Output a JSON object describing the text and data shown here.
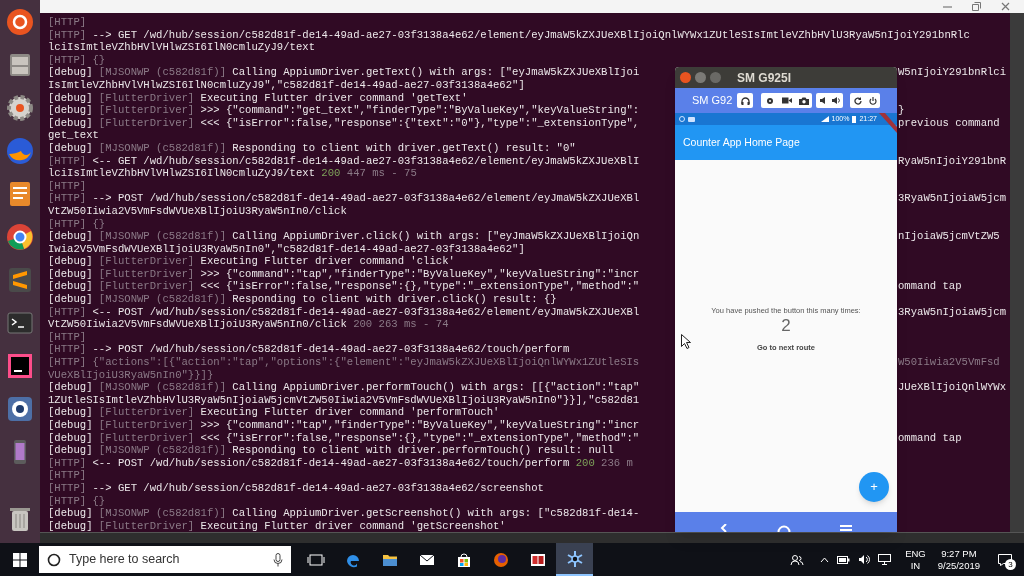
{
  "terminal": {
    "lines": [
      {
        "left": [
          {
            "kind": "dim",
            "text": "[HTTP]"
          }
        ]
      },
      {
        "left": [
          {
            "kind": "dim",
            "text": "[HTTP]"
          },
          {
            "kind": "plain",
            "text": " --> GET /wd/hub/session/c582d81f-de14-49ad-ae27-03f3138a4e62/element/eyJmaW5kZXJUeXBlIjoiQnlWYWx1ZUtleSIsImtleVZhbHVlU3RyaW5nIjoiY291bnRlc"
          }
        ]
      },
      {
        "left": [
          {
            "kind": "plain",
            "text": "lciIsImtleVZhbHVlVHlwZSI6IlN0cmluZyJ9/text"
          }
        ]
      },
      {
        "left": [
          {
            "kind": "dim",
            "text": "[HTTP] {}"
          }
        ]
      },
      {
        "left": [
          {
            "kind": "plain",
            "text": "[debug] "
          },
          {
            "kind": "dim",
            "text": "[MJSONWP (c582d81f)]"
          },
          {
            "kind": "plain",
            "text": " Calling AppiumDriver.getText() with args: [\"eyJmaW5kZXJUeXBlIjoi"
          }
        ],
        "right": [
          {
            "kind": "plain",
            "text": "W5nIjoiY291bnRlci"
          }
        ]
      },
      {
        "left": [
          {
            "kind": "plain",
            "text": "IsImtleVZhbHVlVHlwZSI6IlN0cmluZyJ9\",\"c582d81f-de14-49ad-ae27-03f3138a4e62\"]"
          }
        ]
      },
      {
        "left": [
          {
            "kind": "plain",
            "text": "[debug] "
          },
          {
            "kind": "dim",
            "text": "[FlutterDriver]"
          },
          {
            "kind": "plain",
            "text": " Executing Flutter driver command 'getText'"
          }
        ]
      },
      {
        "left": [
          {
            "kind": "plain",
            "text": "[debug] "
          },
          {
            "kind": "dim",
            "text": "[FlutterDriver]"
          },
          {
            "kind": "plain",
            "text": " >>> {\"command\":\"get_text\",\"finderType\":\"ByValueKey\",\"keyValueString\":"
          }
        ],
        "right": [
          {
            "kind": "plain",
            "text": "}"
          }
        ]
      },
      {
        "left": [
          {
            "kind": "plain",
            "text": "[debug] "
          },
          {
            "kind": "dim",
            "text": "[FlutterDriver]"
          },
          {
            "kind": "plain",
            "text": " <<< {\"isError\":false,\"response\":{\"text\":\"0\"},\"type\":\"_extensionType\","
          }
        ],
        "right": [
          {
            "kind": "plain",
            "text": "previous command"
          }
        ]
      },
      {
        "left": [
          {
            "kind": "plain",
            "text": "get_text"
          }
        ]
      },
      {
        "left": [
          {
            "kind": "plain",
            "text": "[debug] "
          },
          {
            "kind": "dim",
            "text": "[MJSONWP (c582d81f)]"
          },
          {
            "kind": "plain",
            "text": " Responding to client with driver.getText() result: \"0\""
          }
        ]
      },
      {
        "left": [
          {
            "kind": "dim",
            "text": "[HTTP]"
          },
          {
            "kind": "plain",
            "text": " <-- GET /wd/hub/session/c582d81f-de14-49ad-ae27-03f3138a4e62/element/eyJmaW5kZXJUeXBlI"
          }
        ],
        "right": [
          {
            "kind": "plain",
            "text": "RyaW5nIjoiY291bnR"
          }
        ]
      },
      {
        "left": [
          {
            "kind": "plain",
            "text": "lciIsImtleVZhbHVlVHlwZSI6IlN0cmluZyJ9/text"
          },
          {
            "kind": "ok",
            "text": " 200"
          },
          {
            "kind": "dim",
            "text": " 447 ms - 75"
          }
        ]
      },
      {
        "left": [
          {
            "kind": "dim",
            "text": "[HTTP]"
          }
        ]
      },
      {
        "left": [
          {
            "kind": "dim",
            "text": "[HTTP]"
          },
          {
            "kind": "plain",
            "text": " --> POST /wd/hub/session/c582d81f-de14-49ad-ae27-03f3138a4e62/element/eyJmaW5kZXJUeXBl"
          }
        ],
        "right": [
          {
            "kind": "plain",
            "text": "3RyaW5nIjoiaW5jcm"
          }
        ]
      },
      {
        "left": [
          {
            "kind": "plain",
            "text": "VtZW50Iiwia2V5VmFsdWVUeXBlIjoiU3RyaW5nIn0/click"
          }
        ]
      },
      {
        "left": [
          {
            "kind": "dim",
            "text": "[HTTP] {}"
          }
        ]
      },
      {
        "left": [
          {
            "kind": "plain",
            "text": "[debug] "
          },
          {
            "kind": "dim",
            "text": "[MJSONWP (c582d81f)]"
          },
          {
            "kind": "plain",
            "text": " Calling AppiumDriver.click() with args: [\"eyJmaW5kZXJUeXBlIjoiQn"
          }
        ],
        "right": [
          {
            "kind": "plain",
            "text": "nIjoiaW5jcmVtZW5"
          }
        ]
      },
      {
        "left": [
          {
            "kind": "plain",
            "text": "Iwia2V5VmFsdWVUeXBlIjoiU3RyaW5nIn0\",\"c582d81f-de14-49ad-ae27-03f3138a4e62\"]"
          }
        ]
      },
      {
        "left": [
          {
            "kind": "plain",
            "text": "[debug] "
          },
          {
            "kind": "dim",
            "text": "[FlutterDriver]"
          },
          {
            "kind": "plain",
            "text": " Executing Flutter driver command 'click'"
          }
        ]
      },
      {
        "left": [
          {
            "kind": "plain",
            "text": "[debug] "
          },
          {
            "kind": "dim",
            "text": "[FlutterDriver]"
          },
          {
            "kind": "plain",
            "text": " >>> {\"command\":\"tap\",\"finderType\":\"ByValueKey\",\"keyValueString\":\"incr"
          }
        ]
      },
      {
        "left": [
          {
            "kind": "plain",
            "text": "[debug] "
          },
          {
            "kind": "dim",
            "text": "[FlutterDriver]"
          },
          {
            "kind": "plain",
            "text": " <<< {\"isError\":false,\"response\":{},\"type\":\"_extensionType\",\"method\":\""
          }
        ],
        "right": [
          {
            "kind": "plain",
            "text": "ommand tap"
          }
        ]
      },
      {
        "left": [
          {
            "kind": "plain",
            "text": "[debug] "
          },
          {
            "kind": "dim",
            "text": "[MJSONWP (c582d81f)]"
          },
          {
            "kind": "plain",
            "text": " Responding to client with driver.click() result: {}"
          }
        ]
      },
      {
        "left": [
          {
            "kind": "dim",
            "text": "[HTTP]"
          },
          {
            "kind": "plain",
            "text": " <-- POST /wd/hub/session/c582d81f-de14-49ad-ae27-03f3138a4e62/element/eyJmaW5kZXJUeXBl"
          }
        ],
        "right": [
          {
            "kind": "plain",
            "text": "3RyaW5nIjoiaW5jcm"
          }
        ]
      },
      {
        "left": [
          {
            "kind": "plain",
            "text": "VtZW50Iiwia2V5VmFsdWVUeXBlIjoiU3RyaW5nIn0/click"
          },
          {
            "kind": "dim",
            "text": " 200 263 ms - 74"
          }
        ]
      },
      {
        "left": [
          {
            "kind": "dim",
            "text": "[HTTP]"
          }
        ]
      },
      {
        "left": [
          {
            "kind": "dim",
            "text": "[HTTP]"
          },
          {
            "kind": "plain",
            "text": " --> POST /wd/hub/session/c582d81f-de14-49ad-ae27-03f3138a4e62/touch/perform"
          }
        ]
      },
      {
        "left": [
          {
            "kind": "dim",
            "text": "[HTTP] {\"actions\":[{\"action\":\"tap\",\"options\":{\"element\":\"eyJmaW5kZXJUeXBlIjoiQnlWYWx1ZUtleSIs"
          }
        ],
        "right": [
          {
            "kind": "dim",
            "text": "W50Iiwia2V5VmFsd"
          }
        ]
      },
      {
        "left": [
          {
            "kind": "dim",
            "text": "VUeXBlIjoiU3RyaW5nIn0\"}}]}"
          }
        ]
      },
      {
        "left": [
          {
            "kind": "plain",
            "text": "[debug] "
          },
          {
            "kind": "dim",
            "text": "[MJSONWP (c582d81f)]"
          },
          {
            "kind": "plain",
            "text": " Calling AppiumDriver.performTouch() with args: [[{\"action\":\"tap\""
          }
        ],
        "right": [
          {
            "kind": "plain",
            "text": "JUeXBlIjoiQnlWYWx"
          }
        ]
      },
      {
        "left": [
          {
            "kind": "plain",
            "text": "1ZUtleSIsImtleVZhbHVlU3RyaW5nIjoiaW5jcmVtZW50Iiwia2V5VmFsdWVUeXBlIjoiU3RyaW5nIn0\"}}],\"c582d81"
          }
        ]
      },
      {
        "left": [
          {
            "kind": "plain",
            "text": "[debug] "
          },
          {
            "kind": "dim",
            "text": "[FlutterDriver]"
          },
          {
            "kind": "plain",
            "text": " Executing Flutter driver command 'performTouch'"
          }
        ]
      },
      {
        "left": [
          {
            "kind": "plain",
            "text": "[debug] "
          },
          {
            "kind": "dim",
            "text": "[FlutterDriver]"
          },
          {
            "kind": "plain",
            "text": " >>> {\"command\":\"tap\",\"finderType\":\"ByValueKey\",\"keyValueString\":\"incr"
          }
        ]
      },
      {
        "left": [
          {
            "kind": "plain",
            "text": "[debug] "
          },
          {
            "kind": "dim",
            "text": "[FlutterDriver]"
          },
          {
            "kind": "plain",
            "text": " <<< {\"isError\":false,\"response\":{},\"type\":\"_extensionType\",\"method\":\""
          }
        ],
        "right": [
          {
            "kind": "plain",
            "text": "ommand tap"
          }
        ]
      },
      {
        "left": [
          {
            "kind": "plain",
            "text": "[debug] "
          },
          {
            "kind": "dim",
            "text": "[MJSONWP (c582d81f)]"
          },
          {
            "kind": "plain",
            "text": " Responding to client with driver.performTouch() result: null"
          }
        ]
      },
      {
        "left": [
          {
            "kind": "dim",
            "text": "[HTTP]"
          },
          {
            "kind": "plain",
            "text": " <-- POST /wd/hub/session/c582d81f-de14-49ad-ae27-03f3138a4e62/touch/perform"
          },
          {
            "kind": "ok",
            "text": " 200"
          },
          {
            "kind": "dim",
            "text": " 236 m"
          }
        ]
      },
      {
        "left": [
          {
            "kind": "dim",
            "text": "[HTTP]"
          }
        ]
      },
      {
        "left": [
          {
            "kind": "dim",
            "text": "[HTTP]"
          },
          {
            "kind": "plain",
            "text": " --> GET /wd/hub/session/c582d81f-de14-49ad-ae27-03f3138a4e62/screenshot"
          }
        ]
      },
      {
        "left": [
          {
            "kind": "dim",
            "text": "[HTTP] {}"
          }
        ]
      },
      {
        "left": [
          {
            "kind": "plain",
            "text": "[debug] "
          },
          {
            "kind": "dim",
            "text": "[MJSONWP (c582d81f)]"
          },
          {
            "kind": "plain",
            "text": " Calling AppiumDriver.getScreenshot() with args: [\"c582d81f-de14-"
          }
        ]
      },
      {
        "left": [
          {
            "kind": "plain",
            "text": "[debug] "
          },
          {
            "kind": "dim",
            "text": "[FlutterDriver]"
          },
          {
            "kind": "plain",
            "text": " Executing Flutter driver command 'getScreenshot'"
          }
        ]
      }
    ]
  },
  "emulator": {
    "title": "SM G925I",
    "device_label": "SM G92",
    "status_bar": {
      "battery": "100%",
      "time": "21:27"
    },
    "app_bar_title": "Counter App Home Page",
    "message": "You have pushed the button this many times:",
    "counter": "2",
    "link": "Go to next route",
    "fab": "+"
  },
  "taskbar": {
    "search": {
      "placeholder": "Type here to search"
    },
    "apps": [
      {
        "selected": false
      },
      {
        "selected": false
      },
      {
        "selected": false
      },
      {
        "selected": false
      },
      {
        "selected": false
      },
      {
        "selected": false
      },
      {
        "selected": false
      },
      {
        "selected": true
      }
    ],
    "language": "ENG",
    "region": "IN",
    "time": "9:27 PM",
    "date": "9/25/2019",
    "notification_count": "3"
  }
}
